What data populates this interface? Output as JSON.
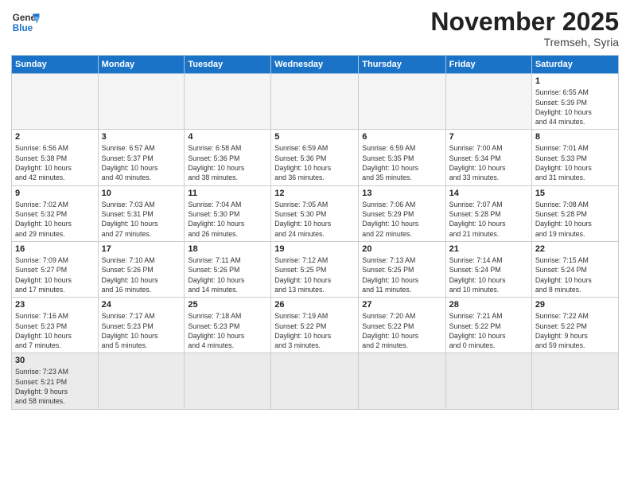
{
  "logo": {
    "general": "General",
    "blue": "Blue"
  },
  "header": {
    "month_year": "November 2025",
    "location": "Tremseh, Syria"
  },
  "weekdays": [
    "Sunday",
    "Monday",
    "Tuesday",
    "Wednesday",
    "Thursday",
    "Friday",
    "Saturday"
  ],
  "weeks": [
    [
      {
        "day": "",
        "info": ""
      },
      {
        "day": "",
        "info": ""
      },
      {
        "day": "",
        "info": ""
      },
      {
        "day": "",
        "info": ""
      },
      {
        "day": "",
        "info": ""
      },
      {
        "day": "",
        "info": ""
      },
      {
        "day": "1",
        "info": "Sunrise: 6:55 AM\nSunset: 5:39 PM\nDaylight: 10 hours\nand 44 minutes."
      }
    ],
    [
      {
        "day": "2",
        "info": "Sunrise: 6:56 AM\nSunset: 5:38 PM\nDaylight: 10 hours\nand 42 minutes."
      },
      {
        "day": "3",
        "info": "Sunrise: 6:57 AM\nSunset: 5:37 PM\nDaylight: 10 hours\nand 40 minutes."
      },
      {
        "day": "4",
        "info": "Sunrise: 6:58 AM\nSunset: 5:36 PM\nDaylight: 10 hours\nand 38 minutes."
      },
      {
        "day": "5",
        "info": "Sunrise: 6:59 AM\nSunset: 5:36 PM\nDaylight: 10 hours\nand 36 minutes."
      },
      {
        "day": "6",
        "info": "Sunrise: 6:59 AM\nSunset: 5:35 PM\nDaylight: 10 hours\nand 35 minutes."
      },
      {
        "day": "7",
        "info": "Sunrise: 7:00 AM\nSunset: 5:34 PM\nDaylight: 10 hours\nand 33 minutes."
      },
      {
        "day": "8",
        "info": "Sunrise: 7:01 AM\nSunset: 5:33 PM\nDaylight: 10 hours\nand 31 minutes."
      }
    ],
    [
      {
        "day": "9",
        "info": "Sunrise: 7:02 AM\nSunset: 5:32 PM\nDaylight: 10 hours\nand 29 minutes."
      },
      {
        "day": "10",
        "info": "Sunrise: 7:03 AM\nSunset: 5:31 PM\nDaylight: 10 hours\nand 27 minutes."
      },
      {
        "day": "11",
        "info": "Sunrise: 7:04 AM\nSunset: 5:30 PM\nDaylight: 10 hours\nand 26 minutes."
      },
      {
        "day": "12",
        "info": "Sunrise: 7:05 AM\nSunset: 5:30 PM\nDaylight: 10 hours\nand 24 minutes."
      },
      {
        "day": "13",
        "info": "Sunrise: 7:06 AM\nSunset: 5:29 PM\nDaylight: 10 hours\nand 22 minutes."
      },
      {
        "day": "14",
        "info": "Sunrise: 7:07 AM\nSunset: 5:28 PM\nDaylight: 10 hours\nand 21 minutes."
      },
      {
        "day": "15",
        "info": "Sunrise: 7:08 AM\nSunset: 5:28 PM\nDaylight: 10 hours\nand 19 minutes."
      }
    ],
    [
      {
        "day": "16",
        "info": "Sunrise: 7:09 AM\nSunset: 5:27 PM\nDaylight: 10 hours\nand 17 minutes."
      },
      {
        "day": "17",
        "info": "Sunrise: 7:10 AM\nSunset: 5:26 PM\nDaylight: 10 hours\nand 16 minutes."
      },
      {
        "day": "18",
        "info": "Sunrise: 7:11 AM\nSunset: 5:26 PM\nDaylight: 10 hours\nand 14 minutes."
      },
      {
        "day": "19",
        "info": "Sunrise: 7:12 AM\nSunset: 5:25 PM\nDaylight: 10 hours\nand 13 minutes."
      },
      {
        "day": "20",
        "info": "Sunrise: 7:13 AM\nSunset: 5:25 PM\nDaylight: 10 hours\nand 11 minutes."
      },
      {
        "day": "21",
        "info": "Sunrise: 7:14 AM\nSunset: 5:24 PM\nDaylight: 10 hours\nand 10 minutes."
      },
      {
        "day": "22",
        "info": "Sunrise: 7:15 AM\nSunset: 5:24 PM\nDaylight: 10 hours\nand 8 minutes."
      }
    ],
    [
      {
        "day": "23",
        "info": "Sunrise: 7:16 AM\nSunset: 5:23 PM\nDaylight: 10 hours\nand 7 minutes."
      },
      {
        "day": "24",
        "info": "Sunrise: 7:17 AM\nSunset: 5:23 PM\nDaylight: 10 hours\nand 5 minutes."
      },
      {
        "day": "25",
        "info": "Sunrise: 7:18 AM\nSunset: 5:23 PM\nDaylight: 10 hours\nand 4 minutes."
      },
      {
        "day": "26",
        "info": "Sunrise: 7:19 AM\nSunset: 5:22 PM\nDaylight: 10 hours\nand 3 minutes."
      },
      {
        "day": "27",
        "info": "Sunrise: 7:20 AM\nSunset: 5:22 PM\nDaylight: 10 hours\nand 2 minutes."
      },
      {
        "day": "28",
        "info": "Sunrise: 7:21 AM\nSunset: 5:22 PM\nDaylight: 10 hours\nand 0 minutes."
      },
      {
        "day": "29",
        "info": "Sunrise: 7:22 AM\nSunset: 5:22 PM\nDaylight: 9 hours\nand 59 minutes."
      }
    ],
    [
      {
        "day": "30",
        "info": "Sunrise: 7:23 AM\nSunset: 5:21 PM\nDaylight: 9 hours\nand 58 minutes."
      },
      {
        "day": "",
        "info": ""
      },
      {
        "day": "",
        "info": ""
      },
      {
        "day": "",
        "info": ""
      },
      {
        "day": "",
        "info": ""
      },
      {
        "day": "",
        "info": ""
      },
      {
        "day": "",
        "info": ""
      }
    ]
  ]
}
